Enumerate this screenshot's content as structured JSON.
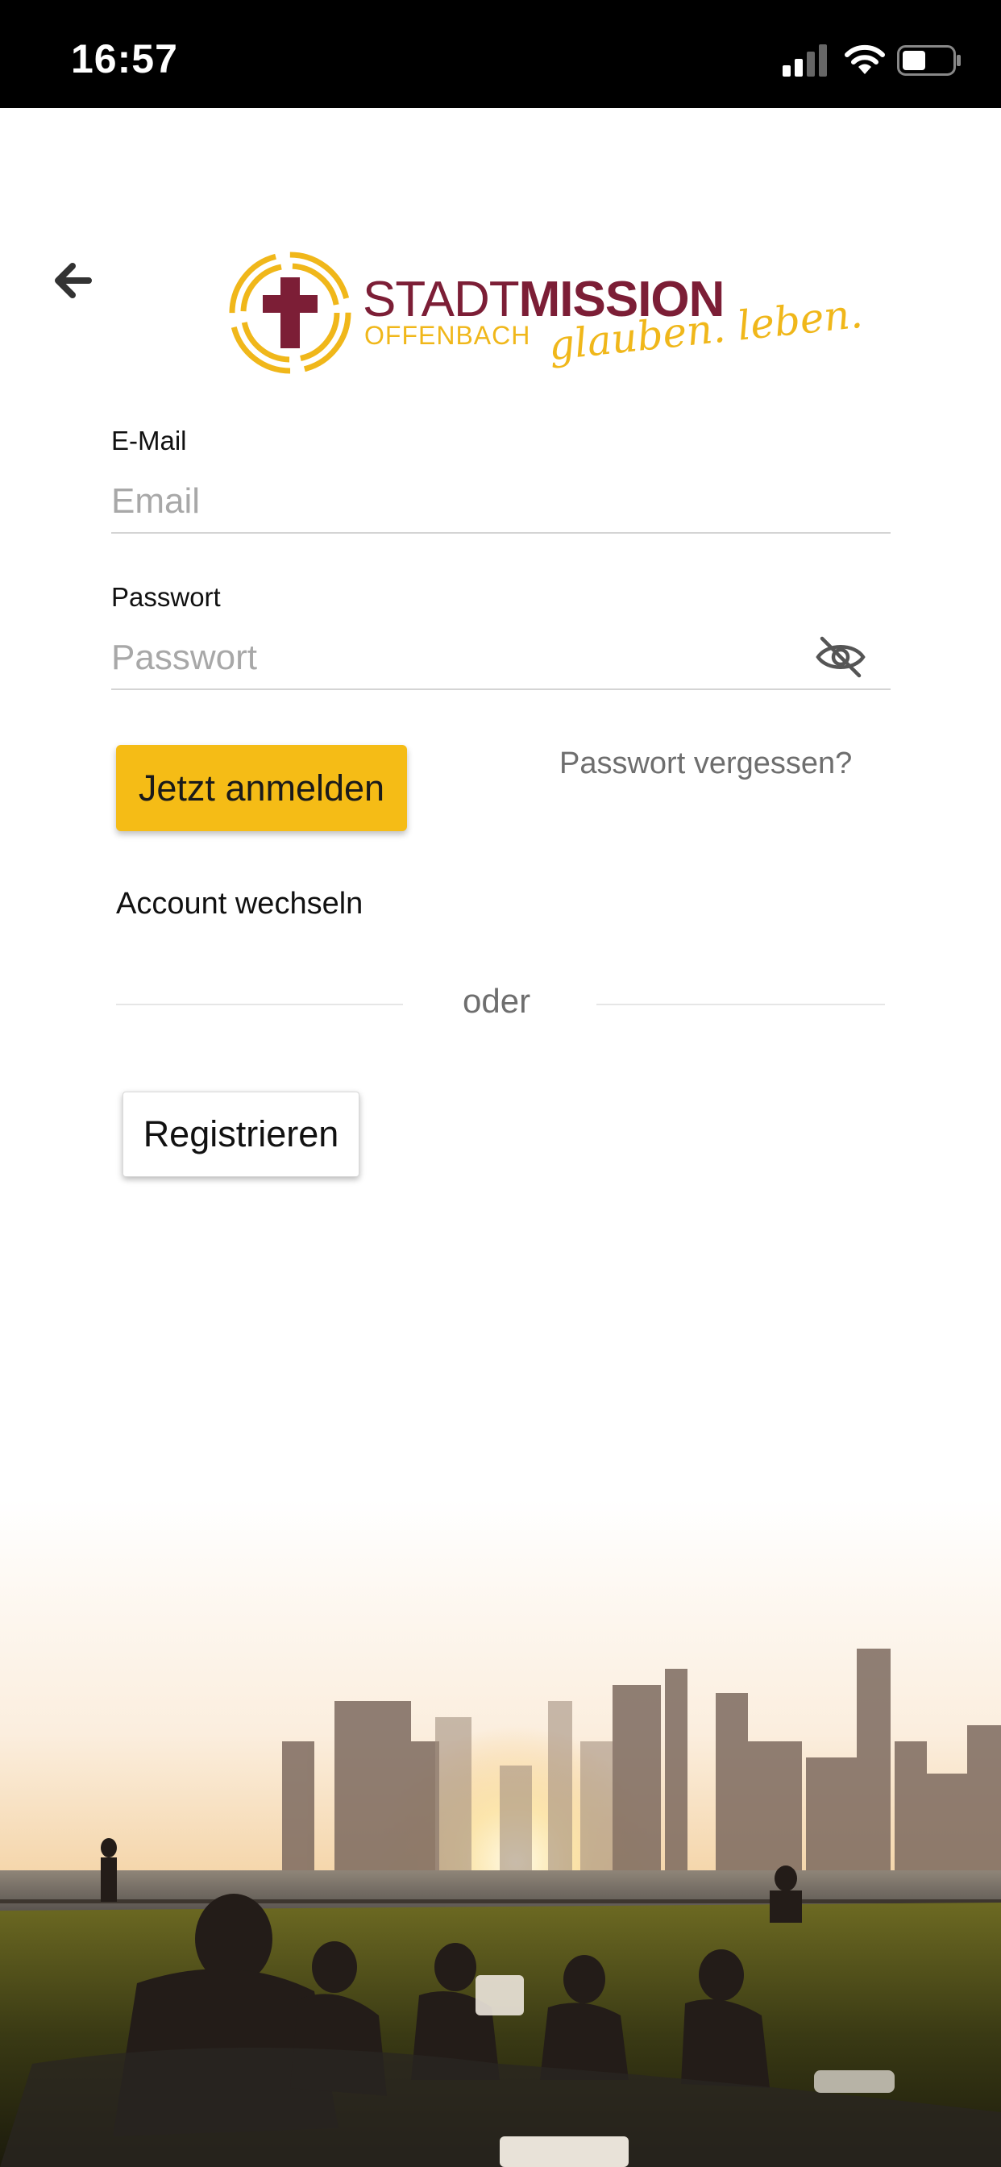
{
  "status_bar": {
    "time": "16:57"
  },
  "logo": {
    "name_light": "STADT",
    "name_bold": "MISSION",
    "city": "OFFENBACH",
    "tagline": "glauben. leben."
  },
  "form": {
    "email": {
      "label": "E-Mail",
      "placeholder": "Email",
      "value": ""
    },
    "password": {
      "label": "Passwort",
      "placeholder": "Passwort",
      "value": ""
    },
    "login_label": "Jetzt anmelden",
    "forgot_label": "Passwort vergessen?",
    "switch_account_label": "Account wechseln",
    "divider_label": "oder",
    "register_label": "Registrieren"
  },
  "icons": {
    "back": "arrow-left-icon",
    "password_toggle": "eye-off-icon",
    "logo_mark": "cross-emblem-icon"
  },
  "colors": {
    "accent": "#f5bc16",
    "brand_red": "#7c1e36",
    "brand_yellow": "#f0b71a"
  }
}
